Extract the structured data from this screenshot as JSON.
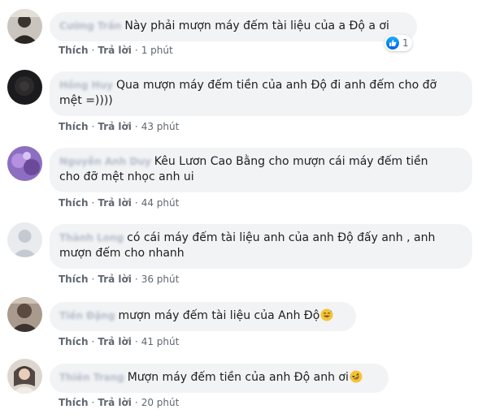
{
  "comments": [
    {
      "author": "Cường Trần",
      "text": "Này phải mượn máy đếm tài liệu của a Độ a ơi",
      "like_label": "Thích",
      "reply_label": "Trả lời",
      "time": "1 phút",
      "reaction_count": "1"
    },
    {
      "author": "Hồng Huy",
      "text_line1": "Qua mượn máy đếm tiền của anh Độ đi anh đếm cho đỡ",
      "text_line2": "mệt =))))",
      "like_label": "Thích",
      "reply_label": "Trả lời",
      "time": "43 phút"
    },
    {
      "author": "Nguyễn Anh Duy",
      "text_line1": "Kêu Lươn Cao Bằng cho mượn cái máy đếm tiền",
      "text_line2": "cho đỡ mệt nhọc anh ui",
      "like_label": "Thích",
      "reply_label": "Trả lời",
      "time": "44 phút"
    },
    {
      "author": "Thành Long",
      "text_line1": "có cái máy đếm tài liệu anh của anh Độ đấy anh , anh",
      "text_line2": "mượn đếm cho nhanh",
      "like_label": "Thích",
      "reply_label": "Trả lời",
      "time": "36 phút"
    },
    {
      "author": "Tiến Đặng",
      "text": "mượn máy đếm tài liệu của Anh Độ",
      "emoji": "grinning-sweat-emoji",
      "like_label": "Thích",
      "reply_label": "Trả lời",
      "time": "41 phút"
    },
    {
      "author": "Thiên Trang",
      "text": "Mượn máy đếm tiền của anh Độ anh ơi",
      "emoji": "rolling-laughing-emoji",
      "like_label": "Thích",
      "reply_label": "Trả lời",
      "time": "20 phút"
    }
  ],
  "colors": {
    "bubble": "#f2f3f5",
    "action_text": "#606770",
    "like_blue": "#1877f2"
  }
}
